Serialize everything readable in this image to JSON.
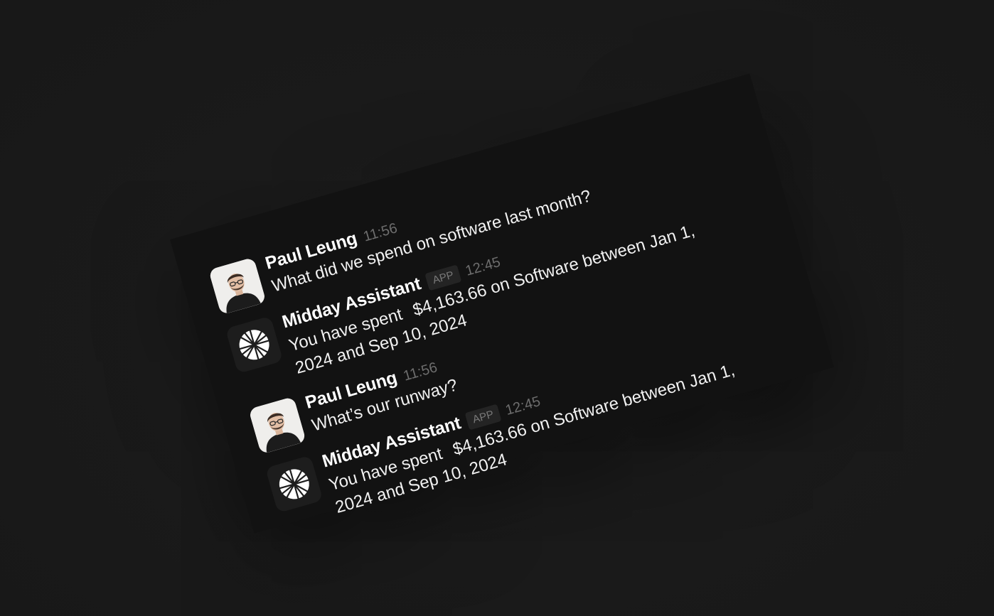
{
  "conversation": [
    {
      "question": {
        "author": "Paul Leung",
        "time": "11:56",
        "text": "What did we spend on software last month?",
        "avatar_icon": "user-photo-avatar"
      },
      "answer": {
        "author": "Midday Assistant",
        "badge": "APP",
        "time": "12:45",
        "text_prefix": "You have spent",
        "amount": "$4,163.66",
        "text_suffix": "on Software between Jan 1, 2024 and Sep 10, 2024",
        "avatar_icon": "midday-logo-icon"
      }
    },
    {
      "question": {
        "author": "Paul Leung",
        "time": "11:56",
        "text": "What’s our runway?",
        "avatar_icon": "user-photo-avatar"
      },
      "answer": {
        "author": "Midday Assistant",
        "badge": "APP",
        "time": "12:45",
        "text_prefix": "You have spent",
        "amount": "$4,163.66",
        "text_suffix": "on Software between Jan 1, 2024 and Sep 10, 2024",
        "avatar_icon": "midday-logo-icon"
      }
    }
  ],
  "colors": {
    "background": "#1a1a1a",
    "card": "#121212",
    "text": "#ffffff",
    "muted": "#6e6e6e"
  }
}
